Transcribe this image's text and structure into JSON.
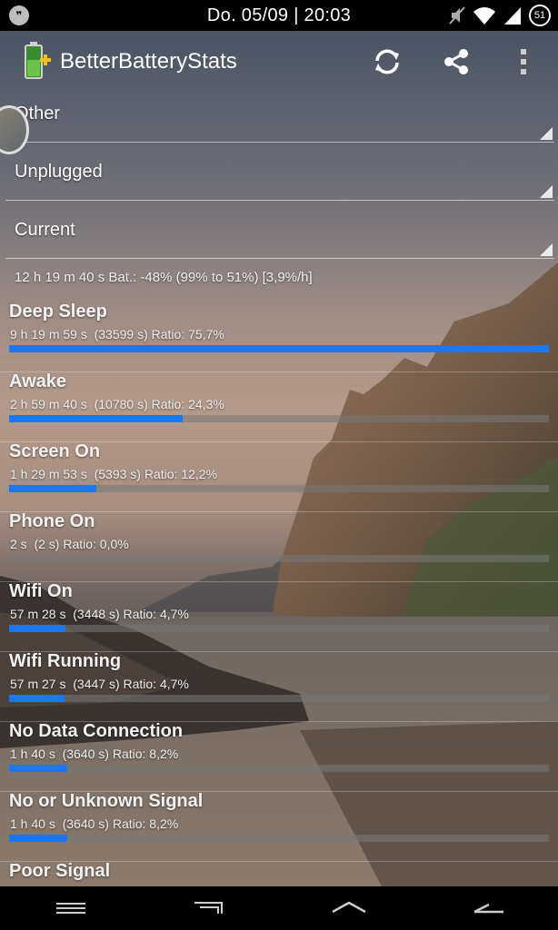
{
  "status_bar": {
    "time": "Do. 05/09 | 20:03",
    "notification_icon": "hangouts-icon",
    "battery_level": "51"
  },
  "app": {
    "title": "BetterBatteryStats",
    "actions": [
      "refresh-icon",
      "share-icon",
      "overflow-menu-icon"
    ]
  },
  "spinners": {
    "category": "Other",
    "from": "Unplugged",
    "to": "Current"
  },
  "summary": "12 h 19 m 40 s  Bat.: -48% (99% to 51%) [3,9%/h]",
  "stats": [
    {
      "title": "Deep Sleep",
      "detail": "9 h 19 m 59 s  (33599 s) Ratio: 75,7%",
      "ratio": 1.0
    },
    {
      "title": "Awake",
      "detail": "2 h 59 m 40 s  (10780 s) Ratio: 24,3%",
      "ratio": 0.321
    },
    {
      "title": "Screen On",
      "detail": "1 h 29 m 53 s  (5393 s) Ratio: 12,2%",
      "ratio": 0.161
    },
    {
      "title": "Phone On",
      "detail": "2 s  (2 s) Ratio: 0,0%",
      "ratio": 0.0
    },
    {
      "title": "Wifi On",
      "detail": "57 m 28 s  (3448 s) Ratio: 4,7%",
      "ratio": 0.104
    },
    {
      "title": "Wifi Running",
      "detail": "57 m 27 s  (3447 s) Ratio: 4,7%",
      "ratio": 0.103
    },
    {
      "title": "No Data Connection",
      "detail": "1 h 40 s  (3640 s) Ratio: 8,2%",
      "ratio": 0.108
    },
    {
      "title": "No or Unknown Signal",
      "detail": "1 h 40 s  (3640 s) Ratio: 8,2%",
      "ratio": 0.108
    },
    {
      "title": "Poor Signal",
      "detail": "",
      "ratio": 0.0
    }
  ],
  "colors": {
    "bar_fill": "#1a78f0",
    "bar_track": "#787878"
  },
  "nav_bar": [
    "menu-icon",
    "recents-icon",
    "home-icon",
    "back-icon"
  ]
}
